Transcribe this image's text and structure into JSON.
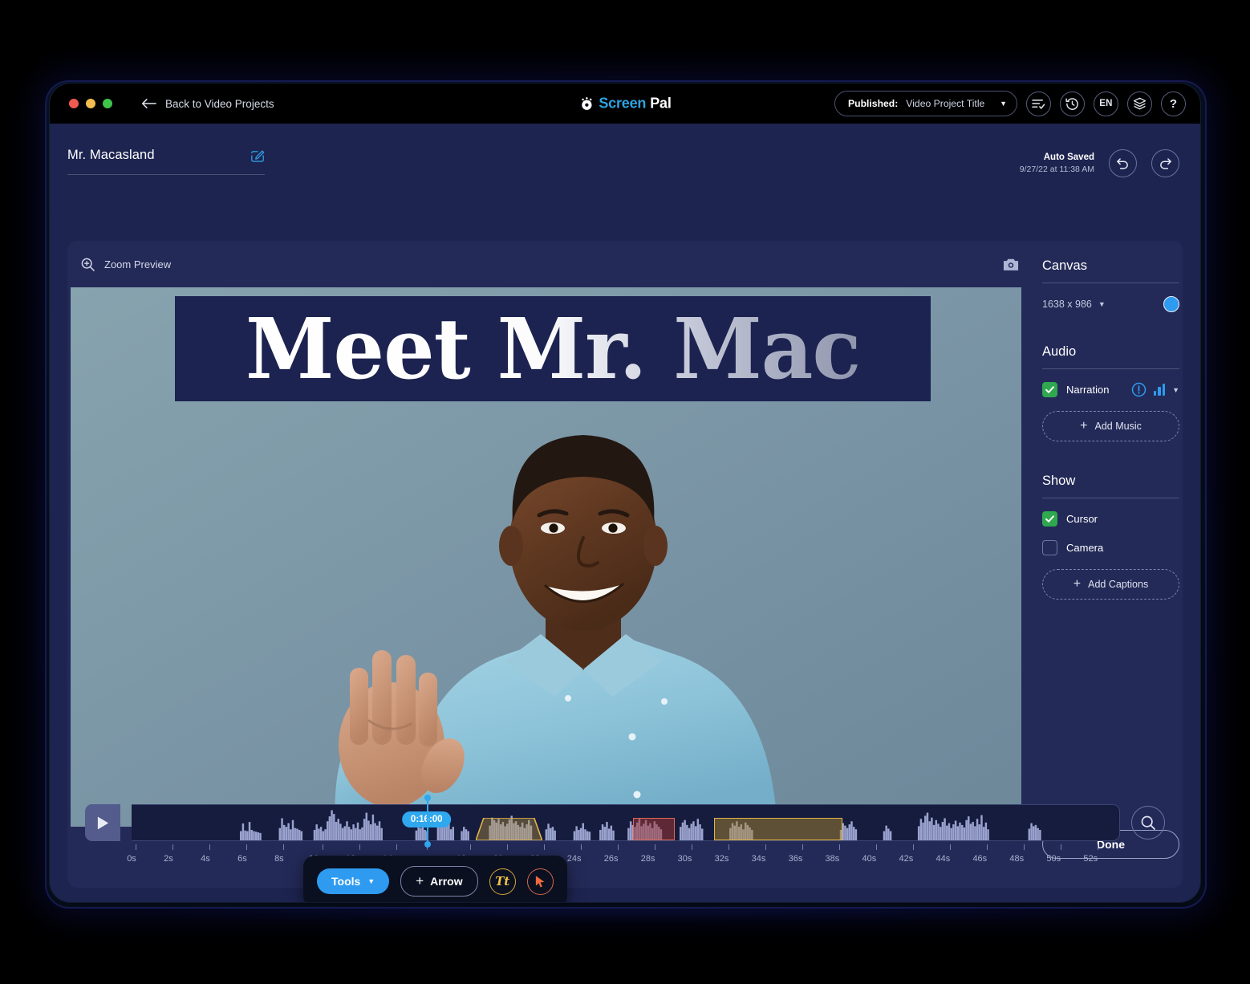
{
  "titlebar": {
    "back_label": "Back to Video Projects",
    "brand_first": "Screen",
    "brand_second": "Pal",
    "publish_prefix": "Published:",
    "publish_title": "Video Project Title",
    "caret": "▼",
    "lang": "EN",
    "help": "?",
    "icons": [
      "checklist-icon",
      "history-icon",
      "language-icon",
      "layers-icon",
      "help-icon"
    ]
  },
  "project": {
    "name": "Mr. Macasland",
    "autosave_title": "Auto Saved",
    "autosave_date": "9/27/22 at 11:38 AM"
  },
  "preview": {
    "zoom_label": "Zoom Preview",
    "canvas_title": "Meet Mr. Mac"
  },
  "tools": {
    "tools_label": "Tools",
    "tools_caret": "▼",
    "arrow_plus": "+",
    "arrow_label": "Arrow",
    "text_label": "Tt"
  },
  "panel": {
    "canvas_head": "Canvas",
    "canvas_size": "1638 x 986",
    "size_caret": "▼",
    "canvas_color": "#2e9bf0",
    "audio_head": "Audio",
    "narration_label": "Narration",
    "audio_caret": "▼",
    "add_music_plus": "+",
    "add_music_label": "Add Music",
    "show_head": "Show",
    "cursor_label": "Cursor",
    "camera_label": "Camera",
    "add_captions_plus": "+",
    "add_captions_label": "Add Captions",
    "done_label": "Done",
    "checked_color": "#2fa84f"
  },
  "timeline": {
    "current_time": "0:16:00",
    "playhead_seconds": 16,
    "total_seconds": 53.6,
    "ticks": [
      "0s",
      "2s",
      "4s",
      "6s",
      "8s",
      "10s",
      "12s",
      "14s",
      "16s",
      "18s",
      "20s",
      "22s",
      "24s",
      "26s",
      "28s",
      "30s",
      "32s",
      "34s",
      "36s",
      "38s",
      "40s",
      "42s",
      "44s",
      "46s",
      "48s",
      "50s",
      "52s"
    ],
    "clips": [
      {
        "name": "gold-trapezoid-clip",
        "start": 18.7,
        "end": 22.3,
        "color": "#bb9644"
      },
      {
        "name": "red-clip",
        "start": 27.2,
        "end": 29.5,
        "color": "#e06a56"
      },
      {
        "name": "gold-rect-clip",
        "start": 31.6,
        "end": 38.6,
        "color": "#e2b54a"
      }
    ],
    "waveform": [
      0,
      0,
      0,
      0,
      0,
      0,
      0,
      0,
      0,
      0,
      0,
      0,
      0,
      0,
      0,
      0,
      0,
      0,
      0,
      0,
      0,
      0,
      0,
      0,
      0,
      0,
      0,
      0,
      0,
      0,
      0,
      0,
      0,
      0,
      0,
      0,
      0,
      0,
      0,
      0,
      0,
      0,
      0,
      0,
      0,
      0,
      0,
      0,
      0,
      0,
      0.3,
      0.55,
      0.32,
      0.3,
      0.6,
      0.34,
      0.3,
      0.28,
      0.26,
      0.24,
      0,
      0,
      0,
      0,
      0,
      0,
      0,
      0,
      0.4,
      0.72,
      0.5,
      0.44,
      0.56,
      0.36,
      0.66,
      0.4,
      0.38,
      0.34,
      0.3,
      0,
      0,
      0,
      0,
      0,
      0.34,
      0.52,
      0.38,
      0.44,
      0.3,
      0.36,
      0.62,
      0.78,
      0.98,
      0.86,
      0.6,
      0.7,
      0.54,
      0.4,
      0.46,
      0.62,
      0.44,
      0.36,
      0.52,
      0.4,
      0.58,
      0.36,
      0.42,
      0.7,
      0.9,
      0.64,
      0.52,
      0.84,
      0.56,
      0.48,
      0.62,
      0.4,
      0,
      0,
      0,
      0,
      0,
      0,
      0,
      0,
      0,
      0,
      0,
      0,
      0,
      0,
      0,
      0.32,
      0.5,
      0.4,
      0.58,
      0.34,
      0.3,
      0,
      0,
      0,
      0,
      0.42,
      0.66,
      0.52,
      0.7,
      0.46,
      0.58,
      0.36,
      0.44,
      0,
      0,
      0,
      0.3,
      0.44,
      0.36,
      0.3,
      0,
      0,
      0,
      0,
      0,
      0,
      0,
      0,
      0,
      0.48,
      0.74,
      0.66,
      0.58,
      0.7,
      0.52,
      0.6,
      0.46,
      0.54,
      0.68,
      0.8,
      0.56,
      0.62,
      0.5,
      0.44,
      0.58,
      0.4,
      0.52,
      0.66,
      0.48,
      0,
      0,
      0,
      0,
      0,
      0,
      0.36,
      0.54,
      0.4,
      0.44,
      0.32,
      0,
      0,
      0,
      0,
      0,
      0,
      0,
      0,
      0.3,
      0.46,
      0.34,
      0.4,
      0.56,
      0.36,
      0.3,
      0.28,
      0,
      0,
      0,
      0,
      0.34,
      0.52,
      0.44,
      0.6,
      0.38,
      0.48,
      0.32,
      0,
      0,
      0,
      0,
      0,
      0,
      0.4,
      0.62,
      0.5,
      0.44,
      0.58,
      0.7,
      0.46,
      0.54,
      0.66,
      0.48,
      0.56,
      0.4,
      0.62,
      0.52,
      0.44,
      0.36,
      0,
      0,
      0,
      0,
      0,
      0,
      0,
      0,
      0.44,
      0.58,
      0.66,
      0.5,
      0.4,
      0.54,
      0.62,
      0.46,
      0.7,
      0.52,
      0.38,
      0,
      0,
      0,
      0,
      0,
      0,
      0,
      0,
      0,
      0,
      0,
      0,
      0.4,
      0.56,
      0.48,
      0.62,
      0.44,
      0.52,
      0.36,
      0.58,
      0.5,
      0.42,
      0.34,
      0,
      0,
      0,
      0,
      0,
      0,
      0,
      0,
      0,
      0,
      0,
      0,
      0,
      0,
      0,
      0,
      0,
      0,
      0,
      0,
      0,
      0,
      0,
      0,
      0,
      0,
      0,
      0,
      0,
      0,
      0,
      0,
      0,
      0,
      0,
      0,
      0,
      0,
      0,
      0,
      0.34,
      0.56,
      0.48,
      0.4,
      0.52,
      0.62,
      0.44,
      0.36,
      0,
      0,
      0,
      0,
      0,
      0,
      0,
      0,
      0,
      0,
      0,
      0,
      0.3,
      0.48,
      0.38,
      0.3,
      0,
      0,
      0,
      0,
      0,
      0,
      0,
      0,
      0,
      0,
      0,
      0,
      0.46,
      0.7,
      0.58,
      0.8,
      0.9,
      0.62,
      0.74,
      0.5,
      0.66,
      0.54,
      0.44,
      0.6,
      0.72,
      0.48,
      0.56,
      0.4,
      0.52,
      0.64,
      0.46,
      0.58,
      0.5,
      0.42,
      0.66,
      0.78,
      0.54,
      0.6,
      0.46,
      0.7,
      0.52,
      0.82,
      0.44,
      0.58,
      0.36,
      0,
      0,
      0,
      0,
      0,
      0,
      0,
      0,
      0,
      0,
      0,
      0,
      0,
      0,
      0,
      0,
      0,
      0,
      0.38,
      0.56,
      0.46,
      0.5,
      0.4,
      0.34,
      0,
      0,
      0,
      0,
      0,
      0,
      0,
      0,
      0,
      0,
      0,
      0,
      0,
      0,
      0,
      0,
      0,
      0,
      0,
      0,
      0,
      0,
      0,
      0,
      0,
      0,
      0,
      0,
      0,
      0,
      0,
      0,
      0,
      0,
      0,
      0
    ]
  }
}
